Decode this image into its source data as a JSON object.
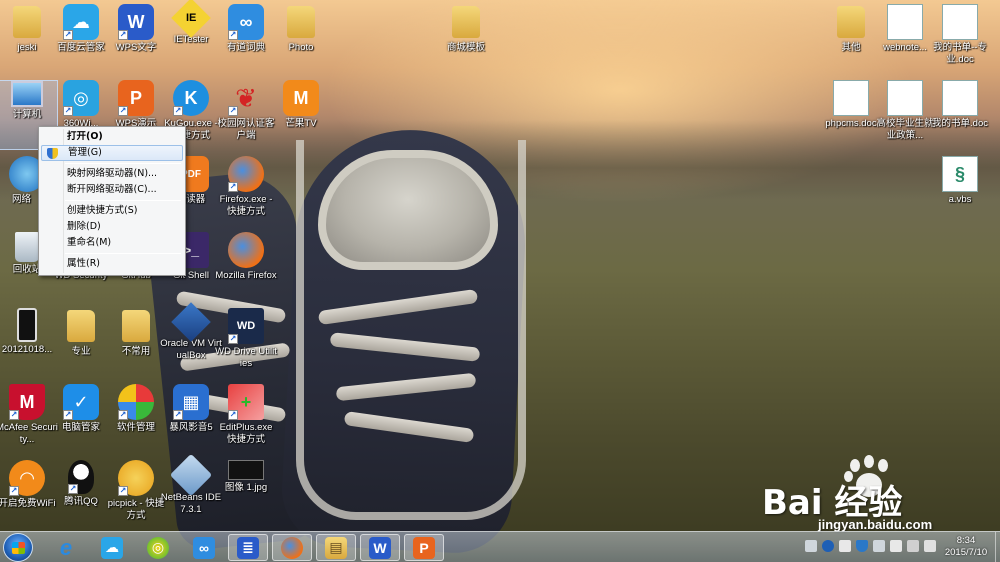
{
  "colors": {
    "menu_bg": "#f5f6f7",
    "menu_hover": "#dbe8f8",
    "taskbar": "#a9b6c2",
    "selection": "#a0c8ff"
  },
  "desktop_icons": [
    {
      "id": "user",
      "label": "jeski",
      "icon": "user-folder-icon"
    },
    {
      "id": "baiduyun",
      "label": "百度云管家",
      "icon": "baidu-cloud-icon"
    },
    {
      "id": "wps-word",
      "label": "WPS文字",
      "icon": "wps-writer-icon"
    },
    {
      "id": "ietester",
      "label": "IETester",
      "icon": "ietester-icon"
    },
    {
      "id": "youdao",
      "label": "有道词典",
      "icon": "youdao-dict-icon"
    },
    {
      "id": "photo",
      "label": "Photo",
      "icon": "folder-icon"
    },
    {
      "id": "mall-template",
      "label": "商城模板",
      "icon": "folder-icon"
    },
    {
      "id": "other",
      "label": "其他",
      "icon": "folder-icon"
    },
    {
      "id": "webnote",
      "label": "webnote...",
      "icon": "word-doc-icon"
    },
    {
      "id": "mybook-top",
      "label": "我的书单--专业.doc",
      "icon": "word-doc-icon"
    },
    {
      "id": "computer",
      "label": "计算机",
      "icon": "computer-icon"
    },
    {
      "id": "360",
      "label": "360Wi...",
      "icon": "360-icon"
    },
    {
      "id": "wps-ppt",
      "label": "WPS演示",
      "icon": "wps-presentation-icon"
    },
    {
      "id": "kugou",
      "label": "KuGou.exe - 快捷方式",
      "icon": "kugou-icon"
    },
    {
      "id": "campus",
      "label": "校园网认证客户端",
      "icon": "butterfly-icon"
    },
    {
      "id": "mangotv",
      "label": "芒果TV",
      "icon": "mango-tv-icon"
    },
    {
      "id": "phpcms",
      "label": "phpcms.doc",
      "icon": "word-doc-icon"
    },
    {
      "id": "graduates",
      "label": "高校毕业生就业政策...",
      "icon": "word-doc-icon"
    },
    {
      "id": "mybook",
      "label": "我的书单.doc",
      "icon": "word-doc-icon"
    },
    {
      "id": "network",
      "label": "网络",
      "icon": "network-icon"
    },
    {
      "id": "pdf",
      "label": "阅读器",
      "icon": "pdf-reader-icon"
    },
    {
      "id": "firefox-shortcut",
      "label": "Firefox.exe - 快捷方式",
      "icon": "firefox-icon"
    },
    {
      "id": "avbs",
      "label": "a.vbs",
      "icon": "vbs-script-icon"
    },
    {
      "id": "recycle",
      "label": "回收站",
      "icon": "recycle-bin-icon"
    },
    {
      "id": "wdsecurity",
      "label": "WD Security",
      "icon": "wd-security-icon"
    },
    {
      "id": "github",
      "label": "GitHub",
      "icon": "github-icon"
    },
    {
      "id": "gitshell",
      "label": "Git Shell",
      "icon": "git-shell-icon"
    },
    {
      "id": "mozilla",
      "label": "Mozilla Firefox",
      "icon": "firefox-icon"
    },
    {
      "id": "photo2012",
      "label": "20121018...",
      "icon": "phone-image-icon"
    },
    {
      "id": "major",
      "label": "专业",
      "icon": "folder-icon"
    },
    {
      "id": "unused",
      "label": "不常用",
      "icon": "folder-icon"
    },
    {
      "id": "vbox",
      "label": "Oracle VM VirtualBox",
      "icon": "virtualbox-icon"
    },
    {
      "id": "wddrive",
      "label": "WD Drive Utilities",
      "icon": "wd-drive-icon"
    },
    {
      "id": "mcafee",
      "label": "McAfee Security...",
      "icon": "mcafee-icon"
    },
    {
      "id": "pcmanager",
      "label": "电脑管家",
      "icon": "pc-manager-icon"
    },
    {
      "id": "softmgr",
      "label": "软件管理",
      "icon": "software-manager-icon"
    },
    {
      "id": "baofeng",
      "label": "暴风影音5",
      "icon": "baofeng-icon"
    },
    {
      "id": "editplus",
      "label": "EditPlus.exe 快捷方式",
      "icon": "editplus-icon"
    },
    {
      "id": "wifi",
      "label": "开启免费WiFi",
      "icon": "wifi-icon"
    },
    {
      "id": "qq",
      "label": "腾讯QQ",
      "icon": "qq-penguin-icon"
    },
    {
      "id": "picpick",
      "label": "picpick - 快捷方式",
      "icon": "picpick-icon"
    },
    {
      "id": "netbeans",
      "label": "NetBeans IDE 7.3.1",
      "icon": "netbeans-icon"
    },
    {
      "id": "image1",
      "label": "图像 1.jpg",
      "icon": "image-file-icon"
    }
  ],
  "context_menu": {
    "items": [
      {
        "label": "打开(O)",
        "bold": true
      },
      {
        "label": "管理(G)",
        "hover": true,
        "shield": true
      },
      {
        "sep": true
      },
      {
        "label": "映射网络驱动器(N)..."
      },
      {
        "label": "断开网络驱动器(C)..."
      },
      {
        "sep": true
      },
      {
        "label": "创建快捷方式(S)"
      },
      {
        "label": "删除(D)"
      },
      {
        "label": "重命名(M)"
      },
      {
        "sep": true
      },
      {
        "label": "属性(R)"
      }
    ]
  },
  "taskbar": {
    "apps": [
      {
        "name": "ie",
        "icon": "ie-icon",
        "glyph": "e"
      },
      {
        "name": "baiduyun",
        "icon": "baidu-cloud-icon",
        "glyph": "☁"
      },
      {
        "name": "browser360",
        "icon": "360-browser-icon",
        "glyph": "◎"
      },
      {
        "name": "youdao",
        "icon": "youdao-dict-icon",
        "glyph": "∞"
      },
      {
        "name": "explorer-alt",
        "icon": "library-icon",
        "glyph": "≣"
      },
      {
        "name": "firefox",
        "icon": "firefox-icon",
        "glyph": "●"
      },
      {
        "name": "explorer",
        "icon": "folder-icon",
        "glyph": "▤"
      },
      {
        "name": "wps-writer",
        "icon": "wps-writer-icon",
        "glyph": "W"
      },
      {
        "name": "wps-presentation",
        "icon": "wps-presentation-icon",
        "glyph": "P"
      }
    ],
    "clock_time": "8:34",
    "clock_date": "2015/7/10"
  },
  "watermark": {
    "brand": "Bai  经验",
    "url": "jingyan.baidu.com"
  }
}
